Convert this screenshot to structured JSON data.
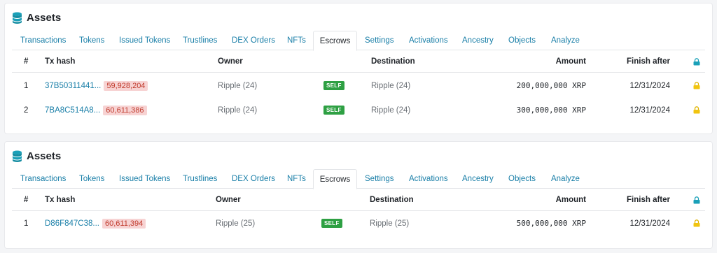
{
  "colors": {
    "link": "#1a7fa8",
    "ledger_badge_bg": "#f7d3d3",
    "ledger_badge_text": "#c0392b",
    "self_badge_bg": "#2ea043",
    "lock_header": "#1aa0b8",
    "lock_row": "#f1c40f"
  },
  "panels": [
    {
      "title": "Assets",
      "tabs": [
        "Transactions",
        "Tokens",
        "Issued Tokens",
        "Trustlines",
        "DEX Orders",
        "NFTs",
        "Escrows",
        "Settings",
        "Activations",
        "Ancestry",
        "Objects",
        "Analyze"
      ],
      "active_tab": "Escrows",
      "columns": {
        "num": "#",
        "tx_hash": "Tx hash",
        "owner": "Owner",
        "destination": "Destination",
        "amount": "Amount",
        "finish_after": "Finish after"
      },
      "rows": [
        {
          "num": "1",
          "tx_hash": "37B50311441...",
          "ledger": "59,928,204",
          "owner": "Ripple (24)",
          "self": "SELF",
          "destination": "Ripple (24)",
          "amount": "200,000,000 XRP",
          "finish_after": "12/31/2024"
        },
        {
          "num": "2",
          "tx_hash": "7BA8C514A8...",
          "ledger": "60,611,386",
          "owner": "Ripple (24)",
          "self": "SELF",
          "destination": "Ripple (24)",
          "amount": "300,000,000 XRP",
          "finish_after": "12/31/2024"
        }
      ]
    },
    {
      "title": "Assets",
      "tabs": [
        "Transactions",
        "Tokens",
        "Issued Tokens",
        "Trustlines",
        "DEX Orders",
        "NFTs",
        "Escrows",
        "Settings",
        "Activations",
        "Ancestry",
        "Objects",
        "Analyze"
      ],
      "active_tab": "Escrows",
      "columns": {
        "num": "#",
        "tx_hash": "Tx hash",
        "owner": "Owner",
        "destination": "Destination",
        "amount": "Amount",
        "finish_after": "Finish after"
      },
      "rows": [
        {
          "num": "1",
          "tx_hash": "D86F847C38...",
          "ledger": "60,611,394",
          "owner": "Ripple (25)",
          "self": "SELF",
          "destination": "Ripple (25)",
          "amount": "500,000,000 XRP",
          "finish_after": "12/31/2024"
        }
      ]
    }
  ]
}
